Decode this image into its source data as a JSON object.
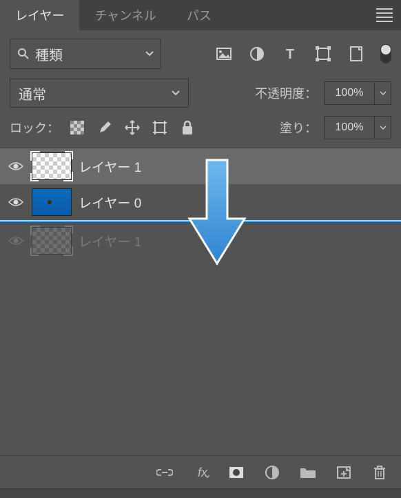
{
  "tabs": {
    "layers": "レイヤー",
    "channels": "チャンネル",
    "paths": "パス"
  },
  "filter": {
    "label": "種類"
  },
  "filter_icons": {
    "image": "image-icon",
    "adjust": "adjustment-icon",
    "type": "type-icon",
    "shape": "shape-icon",
    "smart": "smartobject-icon"
  },
  "blend": {
    "mode": "通常",
    "opacity_label": "不透明度：",
    "opacity_value": "100%"
  },
  "lock": {
    "label": "ロック：",
    "fill_label": "塗り：",
    "fill_value": "100%"
  },
  "layers": [
    {
      "name": "レイヤー 1",
      "thumb": "checker",
      "selected": true,
      "corners": true,
      "visible": true
    },
    {
      "name": "レイヤー 0",
      "thumb": "image",
      "selected": false,
      "corners": false,
      "visible": true
    },
    {
      "name": "レイヤー 1",
      "thumb": "checker-dark",
      "selected": false,
      "corners": true,
      "visible": false,
      "ghost": true
    }
  ]
}
